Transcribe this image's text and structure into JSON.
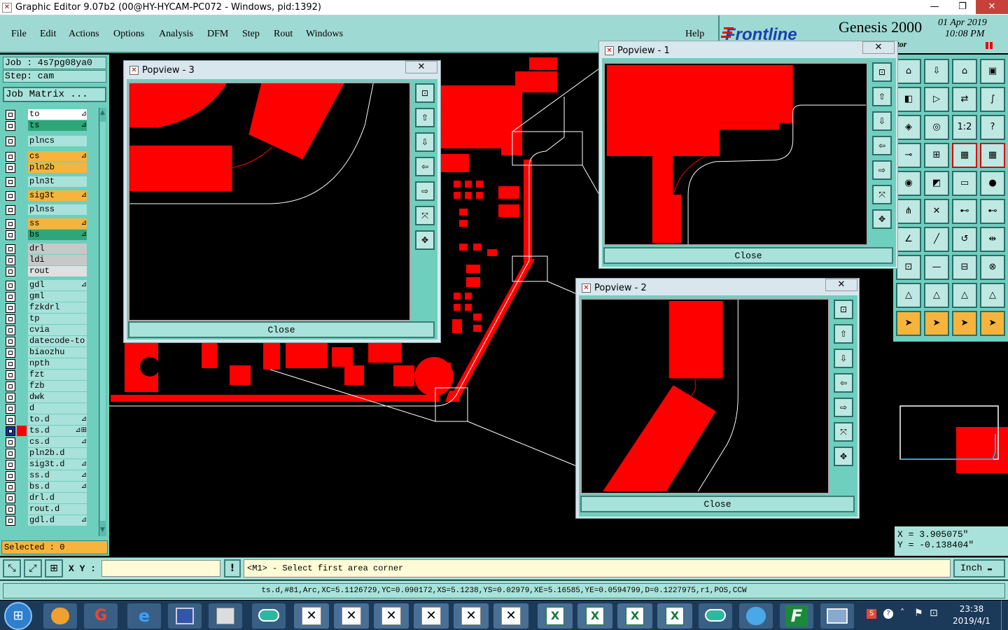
{
  "window": {
    "title": "Graphic Editor 9.07b2 (00@HY-HYCAM-PC072 - Windows, pid:1392)",
    "min": "—",
    "max": "❐",
    "close": "✕"
  },
  "menus": [
    "File",
    "Edit",
    "Actions",
    "Options",
    "Analysis",
    "DFM",
    "Step",
    "Rout",
    "Windows"
  ],
  "menu_help": "Help",
  "brand": {
    "logo": "Frontline",
    "product": "Genesis 2000",
    "date": "01 Apr 2019",
    "time": "10:08 PM",
    "sub": "ditor"
  },
  "job": {
    "job_line": "Job : 4s7pg08ya0",
    "step_line": "Step: cam",
    "matrix_button": "Job Matrix ..."
  },
  "layers": [
    {
      "name": "to",
      "color": "#ffffff",
      "mark": "⊿"
    },
    {
      "name": "ts",
      "color": "#2fa67a",
      "mark": "⊿"
    },
    {
      "name": "plncs",
      "color": "#a8e2da",
      "mark": ""
    },
    {
      "name": "cs",
      "color": "#f6b43c",
      "mark": "⊿"
    },
    {
      "name": "pln2b",
      "color": "#f6b43c",
      "mark": ""
    },
    {
      "name": "pln3t",
      "color": "#a8e2da",
      "mark": ""
    },
    {
      "name": "sig3t",
      "color": "#f6b43c",
      "mark": "⊿"
    },
    {
      "name": "plnss",
      "color": "#a8e2da",
      "mark": ""
    },
    {
      "name": "ss",
      "color": "#f6b43c",
      "mark": "⊿"
    },
    {
      "name": "bs",
      "color": "#2fa67a",
      "mark": "⊿"
    },
    {
      "name": "drl",
      "color": "#c8c8c8",
      "mark": ""
    },
    {
      "name": "ldi",
      "color": "#c8c8c8",
      "mark": ""
    },
    {
      "name": "rout",
      "color": "#e0e0e0",
      "mark": ""
    },
    {
      "name": "gdl",
      "color": "#a8e2da",
      "mark": "⊿"
    },
    {
      "name": "gml",
      "color": "#a8e2da",
      "mark": ""
    },
    {
      "name": "fzkdrl",
      "color": "#a8e2da",
      "mark": ""
    },
    {
      "name": "tp",
      "color": "#a8e2da",
      "mark": ""
    },
    {
      "name": "cvia",
      "color": "#a8e2da",
      "mark": ""
    },
    {
      "name": "datecode-to",
      "color": "#a8e2da",
      "mark": ""
    },
    {
      "name": "biaozhu",
      "color": "#a8e2da",
      "mark": ""
    },
    {
      "name": "npth",
      "color": "#a8e2da",
      "mark": ""
    },
    {
      "name": "fzt",
      "color": "#a8e2da",
      "mark": ""
    },
    {
      "name": "fzb",
      "color": "#a8e2da",
      "mark": ""
    },
    {
      "name": "dwk",
      "color": "#a8e2da",
      "mark": ""
    },
    {
      "name": "d",
      "color": "#a8e2da",
      "mark": ""
    },
    {
      "name": "to.d",
      "color": "#a8e2da",
      "mark": "⊿"
    },
    {
      "name": "ts.d",
      "color": "#a8e2da",
      "mark": "⊿⊞",
      "active": true
    },
    {
      "name": "cs.d",
      "color": "#a8e2da",
      "mark": "⊿"
    },
    {
      "name": "pln2b.d",
      "color": "#a8e2da",
      "mark": ""
    },
    {
      "name": "sig3t.d",
      "color": "#a8e2da",
      "mark": "⊿"
    },
    {
      "name": "ss.d",
      "color": "#a8e2da",
      "mark": "⊿"
    },
    {
      "name": "bs.d",
      "color": "#a8e2da",
      "mark": "⊿"
    },
    {
      "name": "drl.d",
      "color": "#a8e2da",
      "mark": ""
    },
    {
      "name": "rout.d",
      "color": "#a8e2da",
      "mark": ""
    },
    {
      "name": "gdl.d",
      "color": "#a8e2da",
      "mark": "⊿"
    }
  ],
  "selected": "Selected : 0",
  "popviews": [
    {
      "title": "Popview - 3",
      "close": "Close"
    },
    {
      "title": "Popview - 1",
      "close": "Close"
    },
    {
      "title": "Popview - 2",
      "close": "Close"
    }
  ],
  "coords": {
    "x": "X = 3.905075\"",
    "y": "Y = -0.138404\""
  },
  "cmd": {
    "xy_label": "X Y :",
    "xy_value": "",
    "alert": "!",
    "prompt": "<M1> - Select first area corner",
    "units": "Inch"
  },
  "status": "ts.d,#81,Arc,XC=5.1126729,YC=0.090172,XS=5.1238,YS=0.02979,XE=5.16585,YE=0.0594799,D=0.1227975,r1,POS,CCW",
  "clock": {
    "time": "23:38",
    "date": "2019/4/1"
  },
  "colors": {
    "accent": "#6fcfbf",
    "copper": "#ff0000",
    "panel": "#a8e2da"
  }
}
